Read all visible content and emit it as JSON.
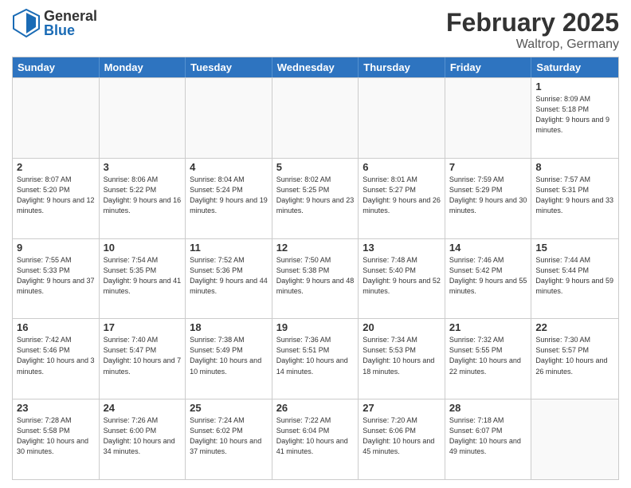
{
  "logo": {
    "general": "General",
    "blue": "Blue"
  },
  "title": {
    "month": "February 2025",
    "location": "Waltrop, Germany"
  },
  "header": {
    "days": [
      "Sunday",
      "Monday",
      "Tuesday",
      "Wednesday",
      "Thursday",
      "Friday",
      "Saturday"
    ]
  },
  "weeks": [
    [
      {
        "day": "",
        "info": ""
      },
      {
        "day": "",
        "info": ""
      },
      {
        "day": "",
        "info": ""
      },
      {
        "day": "",
        "info": ""
      },
      {
        "day": "",
        "info": ""
      },
      {
        "day": "",
        "info": ""
      },
      {
        "day": "1",
        "info": "Sunrise: 8:09 AM\nSunset: 5:18 PM\nDaylight: 9 hours and 9 minutes."
      }
    ],
    [
      {
        "day": "2",
        "info": "Sunrise: 8:07 AM\nSunset: 5:20 PM\nDaylight: 9 hours and 12 minutes."
      },
      {
        "day": "3",
        "info": "Sunrise: 8:06 AM\nSunset: 5:22 PM\nDaylight: 9 hours and 16 minutes."
      },
      {
        "day": "4",
        "info": "Sunrise: 8:04 AM\nSunset: 5:24 PM\nDaylight: 9 hours and 19 minutes."
      },
      {
        "day": "5",
        "info": "Sunrise: 8:02 AM\nSunset: 5:25 PM\nDaylight: 9 hours and 23 minutes."
      },
      {
        "day": "6",
        "info": "Sunrise: 8:01 AM\nSunset: 5:27 PM\nDaylight: 9 hours and 26 minutes."
      },
      {
        "day": "7",
        "info": "Sunrise: 7:59 AM\nSunset: 5:29 PM\nDaylight: 9 hours and 30 minutes."
      },
      {
        "day": "8",
        "info": "Sunrise: 7:57 AM\nSunset: 5:31 PM\nDaylight: 9 hours and 33 minutes."
      }
    ],
    [
      {
        "day": "9",
        "info": "Sunrise: 7:55 AM\nSunset: 5:33 PM\nDaylight: 9 hours and 37 minutes."
      },
      {
        "day": "10",
        "info": "Sunrise: 7:54 AM\nSunset: 5:35 PM\nDaylight: 9 hours and 41 minutes."
      },
      {
        "day": "11",
        "info": "Sunrise: 7:52 AM\nSunset: 5:36 PM\nDaylight: 9 hours and 44 minutes."
      },
      {
        "day": "12",
        "info": "Sunrise: 7:50 AM\nSunset: 5:38 PM\nDaylight: 9 hours and 48 minutes."
      },
      {
        "day": "13",
        "info": "Sunrise: 7:48 AM\nSunset: 5:40 PM\nDaylight: 9 hours and 52 minutes."
      },
      {
        "day": "14",
        "info": "Sunrise: 7:46 AM\nSunset: 5:42 PM\nDaylight: 9 hours and 55 minutes."
      },
      {
        "day": "15",
        "info": "Sunrise: 7:44 AM\nSunset: 5:44 PM\nDaylight: 9 hours and 59 minutes."
      }
    ],
    [
      {
        "day": "16",
        "info": "Sunrise: 7:42 AM\nSunset: 5:46 PM\nDaylight: 10 hours and 3 minutes."
      },
      {
        "day": "17",
        "info": "Sunrise: 7:40 AM\nSunset: 5:47 PM\nDaylight: 10 hours and 7 minutes."
      },
      {
        "day": "18",
        "info": "Sunrise: 7:38 AM\nSunset: 5:49 PM\nDaylight: 10 hours and 10 minutes."
      },
      {
        "day": "19",
        "info": "Sunrise: 7:36 AM\nSunset: 5:51 PM\nDaylight: 10 hours and 14 minutes."
      },
      {
        "day": "20",
        "info": "Sunrise: 7:34 AM\nSunset: 5:53 PM\nDaylight: 10 hours and 18 minutes."
      },
      {
        "day": "21",
        "info": "Sunrise: 7:32 AM\nSunset: 5:55 PM\nDaylight: 10 hours and 22 minutes."
      },
      {
        "day": "22",
        "info": "Sunrise: 7:30 AM\nSunset: 5:57 PM\nDaylight: 10 hours and 26 minutes."
      }
    ],
    [
      {
        "day": "23",
        "info": "Sunrise: 7:28 AM\nSunset: 5:58 PM\nDaylight: 10 hours and 30 minutes."
      },
      {
        "day": "24",
        "info": "Sunrise: 7:26 AM\nSunset: 6:00 PM\nDaylight: 10 hours and 34 minutes."
      },
      {
        "day": "25",
        "info": "Sunrise: 7:24 AM\nSunset: 6:02 PM\nDaylight: 10 hours and 37 minutes."
      },
      {
        "day": "26",
        "info": "Sunrise: 7:22 AM\nSunset: 6:04 PM\nDaylight: 10 hours and 41 minutes."
      },
      {
        "day": "27",
        "info": "Sunrise: 7:20 AM\nSunset: 6:06 PM\nDaylight: 10 hours and 45 minutes."
      },
      {
        "day": "28",
        "info": "Sunrise: 7:18 AM\nSunset: 6:07 PM\nDaylight: 10 hours and 49 minutes."
      },
      {
        "day": "",
        "info": ""
      }
    ]
  ]
}
